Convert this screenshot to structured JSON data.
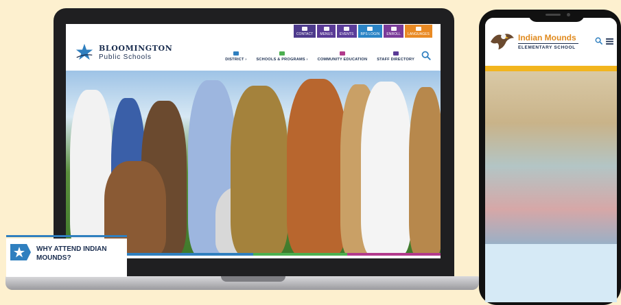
{
  "colors": {
    "navy": "#1a2d4f",
    "accent_blue": "#2f7fbf",
    "indian_orange": "#e08a1e",
    "indian_yellow": "#f2b51e"
  },
  "laptop": {
    "utility_bar": [
      {
        "label": "CONTACT",
        "color": "#4d3a8c",
        "icon": "chat-icon"
      },
      {
        "label": "MENUS",
        "color": "#5a3a96",
        "icon": "utensils-icon"
      },
      {
        "label": "EVENTS",
        "color": "#5b3d9a",
        "icon": "calendar-icon"
      },
      {
        "label": "BPS LOGIN",
        "color": "#2b84c6",
        "icon": "key-icon"
      },
      {
        "label": "ENROLL",
        "color": "#7a3b99",
        "icon": "enroll-icon"
      },
      {
        "label": "LANGUAGES",
        "color": "#e98a24",
        "icon": "globe-icon"
      }
    ],
    "logo": {
      "line1": "BLOOMINGTON",
      "line2": "Public Schools"
    },
    "nav": [
      {
        "label": "DISTRICT ›",
        "color": "#2f7fbf"
      },
      {
        "label": "SCHOOLS & PROGRAMS ›",
        "color": "#4caf50"
      },
      {
        "label": "COMMUNITY EDUCATION",
        "color": "#b23a8c"
      },
      {
        "label": "STAFF DIRECTORY",
        "color": "#5a3a96"
      }
    ],
    "hero_stripes": [
      "#2f7fbf",
      "#2f7fbf",
      "#4caf50",
      "#b23a8c"
    ]
  },
  "phone": {
    "title": "Indian Mounds",
    "subtitle": "ELEMENTARY SCHOOL",
    "cta": "WHY ATTEND INDIAN MOUNDS?"
  }
}
